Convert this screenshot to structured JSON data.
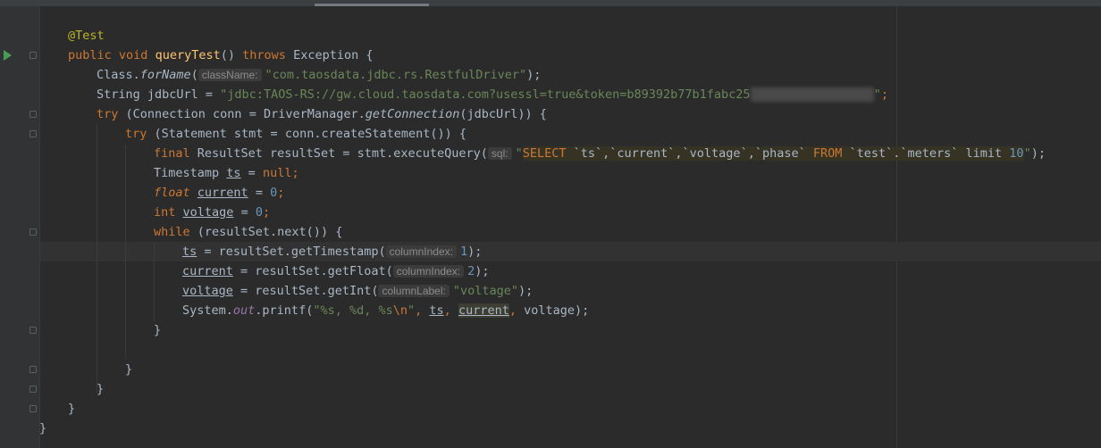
{
  "editor": {
    "lines": {
      "l1": {
        "annotation": "@Test"
      },
      "l2": {
        "kw_public": "public",
        "kw_void": "void",
        "method": "queryTest",
        "paren": "()",
        "kw_throws": "throws",
        "exception": "Exception {"
      },
      "l3": {
        "class": "Class.",
        "forName": "forName",
        "open": "(",
        "hint": "className:",
        "str": "\"com.taosdata.jdbc.rs.RestfulDriver\"",
        "close": ");"
      },
      "l4": {
        "decl": "String jdbcUrl = ",
        "str": "\"jdbc:TAOS-RS://gw.cloud.taosdata.com?usessl=true&token=b89392b77b1fabc25",
        "blurred": "xxxxxxxxxxxxxxxxx",
        "str_end": "\"",
        "end": ";"
      },
      "l5": {
        "kw_try": "try",
        "a": " (Connection conn = DriverManager.",
        "getConnection": "getConnection",
        "b": "(jdbcUrl)) {"
      },
      "l6": {
        "kw_try": "try",
        "a": " (Statement stmt = conn.createStatement()) {"
      },
      "l7": {
        "kw_final": "final",
        "a": " ResultSet resultSet = stmt.executeQuery(",
        "hint": "sql:",
        "q_open": "\"",
        "sql_select": "SELECT",
        "sql_cols": " `ts`,`current`,`voltage`,`phase` ",
        "sql_from": "FROM",
        "sql_table": " `test`.`meters` limit ",
        "sql_limit": "10",
        "q_close": "\"",
        "close": ");"
      },
      "l8": {
        "a": "Timestamp ",
        "var": "ts",
        "b": " = ",
        "kw_null": "null",
        "end": ";"
      },
      "l9": {
        "kw": "float",
        "sp": " ",
        "var": "current",
        "b": " = ",
        "num": "0",
        "end": ";"
      },
      "l10": {
        "kw": "int",
        "sp": " ",
        "var": "voltage",
        "b": " = ",
        "num": "0",
        "end": ";"
      },
      "l11": {
        "kw_while": "while",
        "a": " (resultSet.next()) {"
      },
      "l12": {
        "var": "ts",
        "a": " = resultSet.getTimestamp(",
        "hint": "columnIndex:",
        "num": "1",
        "close": ");"
      },
      "l13": {
        "var": "current",
        "a": " = resultSet.getFloat(",
        "hint": "columnIndex:",
        "num": "2",
        "close": ");"
      },
      "l14": {
        "var": "voltage",
        "a": " = resultSet.getInt(",
        "hint": "columnLabel:",
        "str": "\"voltage\"",
        "close": ");"
      },
      "l15": {
        "a": "System.",
        "out": "out",
        "b": ".printf(",
        "str1": "\"%s, %d, %s",
        "esc": "\\n",
        "str2": "\"",
        "sep1": ", ",
        "v1": "ts",
        "sep2": ", ",
        "v2": "current",
        "sep3": ", ",
        "v3": "voltage",
        "close": ");"
      },
      "l16": {
        "brace": "}"
      },
      "l18": {
        "brace": "}"
      },
      "l19": {
        "brace": "}"
      },
      "l20": {
        "brace": "}"
      },
      "l21": {
        "brace": "}"
      }
    }
  }
}
